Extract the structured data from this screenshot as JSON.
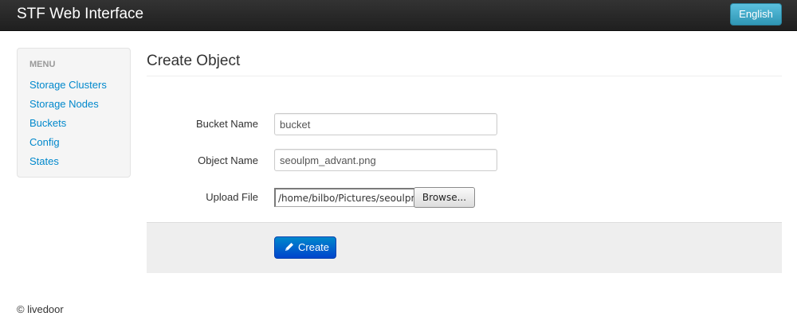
{
  "navbar": {
    "brand": "STF Web Interface",
    "language_button": "English",
    "accent_color": "#5bc0de"
  },
  "sidebar": {
    "header": "MENU",
    "items": [
      {
        "label": "Storage Clusters"
      },
      {
        "label": "Storage Nodes"
      },
      {
        "label": "Buckets"
      },
      {
        "label": "Config"
      },
      {
        "label": "States"
      }
    ]
  },
  "main": {
    "title": "Create Object",
    "form": {
      "bucket_name": {
        "label": "Bucket Name",
        "value": "bucket"
      },
      "object_name": {
        "label": "Object Name",
        "value": "seoulpm_advant.png"
      },
      "upload_file": {
        "label": "Upload File",
        "value": "/home/bilbo/Pictures/seoulpm_advant.png",
        "browse_label": "Browse..."
      },
      "submit": {
        "label": "Create",
        "icon": "pencil-icon",
        "color": "#0074cc"
      }
    }
  },
  "footer": {
    "text": "© livedoor"
  }
}
